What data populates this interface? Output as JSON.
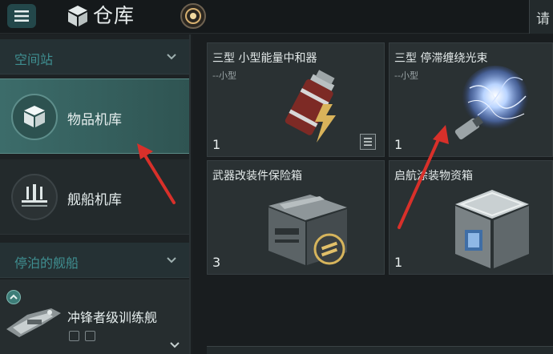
{
  "header": {
    "title": "仓库",
    "right_button": "请"
  },
  "sidebar": {
    "section1": {
      "label": "空间站"
    },
    "items": [
      {
        "label": "物品机库",
        "active": true
      },
      {
        "label": "舰船机库",
        "active": false
      }
    ],
    "section2": {
      "label": "停泊的舰船"
    },
    "ship": {
      "label": "冲锋者级训练舰"
    }
  },
  "items": [
    {
      "name": "三型 小型能量中和器",
      "sub": "--小型",
      "qty": "1",
      "icon": "battery-lightning-icon"
    },
    {
      "name": "三型 停滞缠绕光束",
      "sub": "--小型",
      "qty": "1",
      "icon": "energy-orb-icon"
    },
    {
      "name": "武器改装件保险箱",
      "sub": "",
      "qty": "3",
      "icon": "crate-icon"
    },
    {
      "name": "启航涂装物资箱",
      "sub": "",
      "qty": "1",
      "icon": "cube-box-icon"
    }
  ],
  "colors": {
    "accent": "#3f8f91",
    "active_bg": "#3c6c6a",
    "arrow": "#d8302a"
  }
}
